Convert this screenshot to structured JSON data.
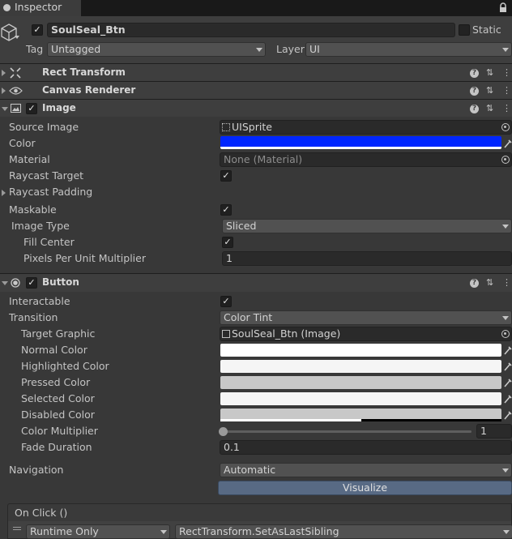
{
  "tab": {
    "title": "Inspector"
  },
  "header": {
    "object_name": "SoulSeal_Btn",
    "static_label": "Static",
    "tag_label": "Tag",
    "tag_value": "Untagged",
    "layer_label": "Layer",
    "layer_value": "UI"
  },
  "components": {
    "rect_transform": {
      "title": "Rect Transform"
    },
    "canvas_renderer": {
      "title": "Canvas Renderer"
    },
    "image": {
      "title": "Image",
      "source_image_label": "Source Image",
      "source_image_value": "UISprite",
      "color_label": "Color",
      "color_value": "#0026ff",
      "material_label": "Material",
      "material_value": "None (Material)",
      "raycast_target_label": "Raycast Target",
      "raycast_padding_label": "Raycast Padding",
      "maskable_label": "Maskable",
      "image_type_label": "Image Type",
      "image_type_value": "Sliced",
      "fill_center_label": "Fill Center",
      "ppu_label": "Pixels Per Unit Multiplier",
      "ppu_value": "1"
    },
    "button": {
      "title": "Button",
      "interactable_label": "Interactable",
      "transition_label": "Transition",
      "transition_value": "Color Tint",
      "target_graphic_label": "Target Graphic",
      "target_graphic_value": "SoulSeal_Btn (Image)",
      "normal_color_label": "Normal Color",
      "normal_color": "#ffffff",
      "highlighted_color_label": "Highlighted Color",
      "highlighted_color": "#f5f5f5",
      "pressed_color_label": "Pressed Color",
      "pressed_color": "#c8c8c8",
      "selected_color_label": "Selected Color",
      "selected_color": "#f5f5f5",
      "disabled_color_label": "Disabled Color",
      "disabled_color": "#c8c8c8",
      "disabled_alpha": 0.5,
      "color_multiplier_label": "Color Multiplier",
      "color_multiplier_value": "1",
      "color_multiplier_fraction": 0,
      "fade_duration_label": "Fade Duration",
      "fade_duration_value": "0.1",
      "navigation_label": "Navigation",
      "navigation_value": "Automatic",
      "visualize_label": "Visualize",
      "on_click_label": "On Click ()",
      "runtime_value": "Runtime Only",
      "function_value": "RectTransform.SetAsLastSibling"
    }
  }
}
